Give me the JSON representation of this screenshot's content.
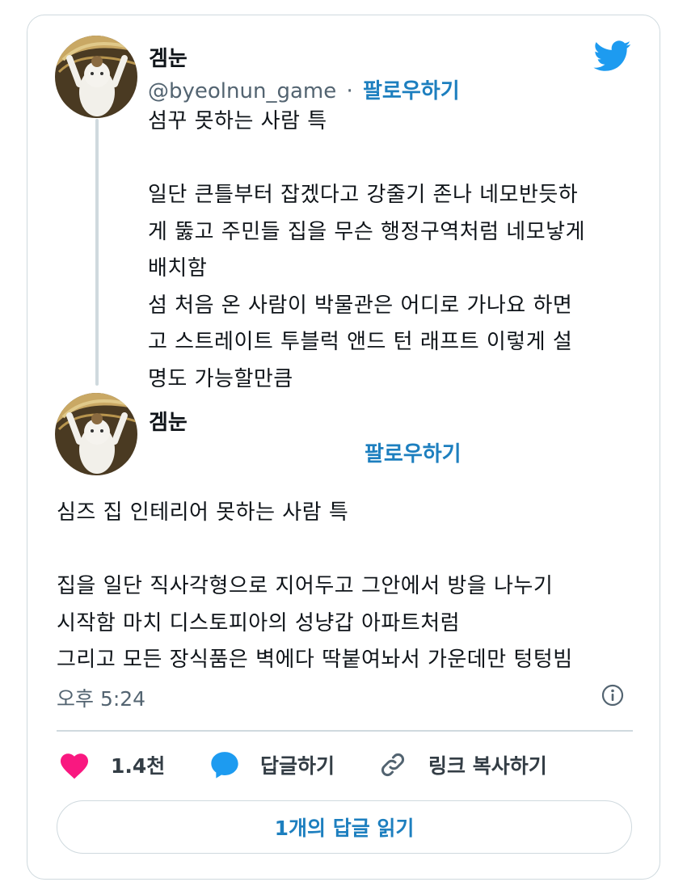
{
  "tweet": {
    "author_name": "겜눈",
    "handle": "@byeolnun_game",
    "separator": "·",
    "follow_label": "팔로우하기",
    "text": "섬꾸 못하는 사람 특\n\n일단 큰틀부터 잡겠다고 강줄기 존나 네모반듯하\n게 뚫고 주민들 집을 무슨 행정구역처럼 네모낳게\n배치함\n섬 처음 온 사람이 박물관은 어디로 가나요 하면\n고 스트레이트 투블럭 앤드 턴 래프트 이렇게 설\n명도 가능할만큼"
  },
  "reply": {
    "author_name": "겜눈",
    "follow_label": "팔로우하기",
    "text": "심즈 집 인테리어 못하는 사람 특\n\n집을 일단 직사각형으로 지어두고 그안에서 방을 나누기\n시작함 마치 디스토피아의 성냥갑 아파트처럼\n그리고 모든 장식품은 벽에다 딱붙여놔서 가운데만 텅텅빔",
    "timestamp": "오후 5:24"
  },
  "actions": {
    "like_count": "1.4천",
    "reply_label": "답글하기",
    "copy_link_label": "링크 복사하기"
  },
  "read_replies_label": "1개의 답글 읽기",
  "colors": {
    "accent": "#1d7fbf",
    "twitter_blue": "#1d9bf0",
    "heart": "#f91880",
    "border": "#cfd9de"
  },
  "icons": {
    "brand": "twitter-bird-icon",
    "like": "heart-icon",
    "reply": "speech-bubble-icon",
    "link": "link-icon",
    "info": "info-icon"
  }
}
